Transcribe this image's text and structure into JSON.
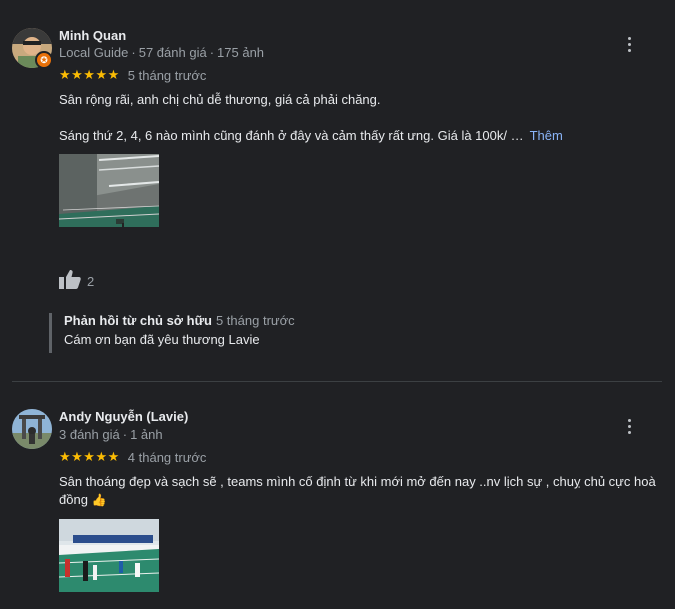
{
  "reviews": [
    {
      "author": "Minh Quan",
      "meta_role": "Local Guide",
      "meta_reviews": "57 đánh giá",
      "meta_photos": "175 ảnh",
      "stars": "★★★★★",
      "rating": 5,
      "time": "5 tháng trước",
      "text_line1": "Sân rộng rãi, anh chị chủ dễ thương, giá cả phải chăng.",
      "text_line2": "Sáng thứ 2, 4, 6 nào mình cũng đánh ở đây và cảm thấy rất ưng. Giá là 100k/ …",
      "more_label": "Thêm",
      "likes": "2",
      "reply": {
        "author": "Phản hồi từ chủ sở hữu",
        "time": "5 tháng trước",
        "body": "Cám ơn bạn đã yêu thương Lavie"
      }
    },
    {
      "author": "Andy Nguyễn (Lavie)",
      "meta_reviews": "3 đánh giá",
      "meta_photos": "1 ảnh",
      "stars": "★★★★★",
      "rating": 5,
      "time": "4 tháng trước",
      "text_line1": "Sân thoáng đẹp và sạch sẽ , teams mình cố định từ khi mới mở đến nay ..nv lịch sự , chuỵ chủ cực hoà",
      "text_line2": "đồng",
      "emoji": "👍"
    }
  ],
  "icons": {
    "more": "more-vert-icon",
    "like": "thumbs-up-icon",
    "guide": "local-guide-badge-icon"
  },
  "colors": {
    "background": "#202124",
    "star": "#fbbc04",
    "link": "#8ab4f8",
    "secondary_text": "#9aa0a6",
    "badge": "#e8710a"
  }
}
